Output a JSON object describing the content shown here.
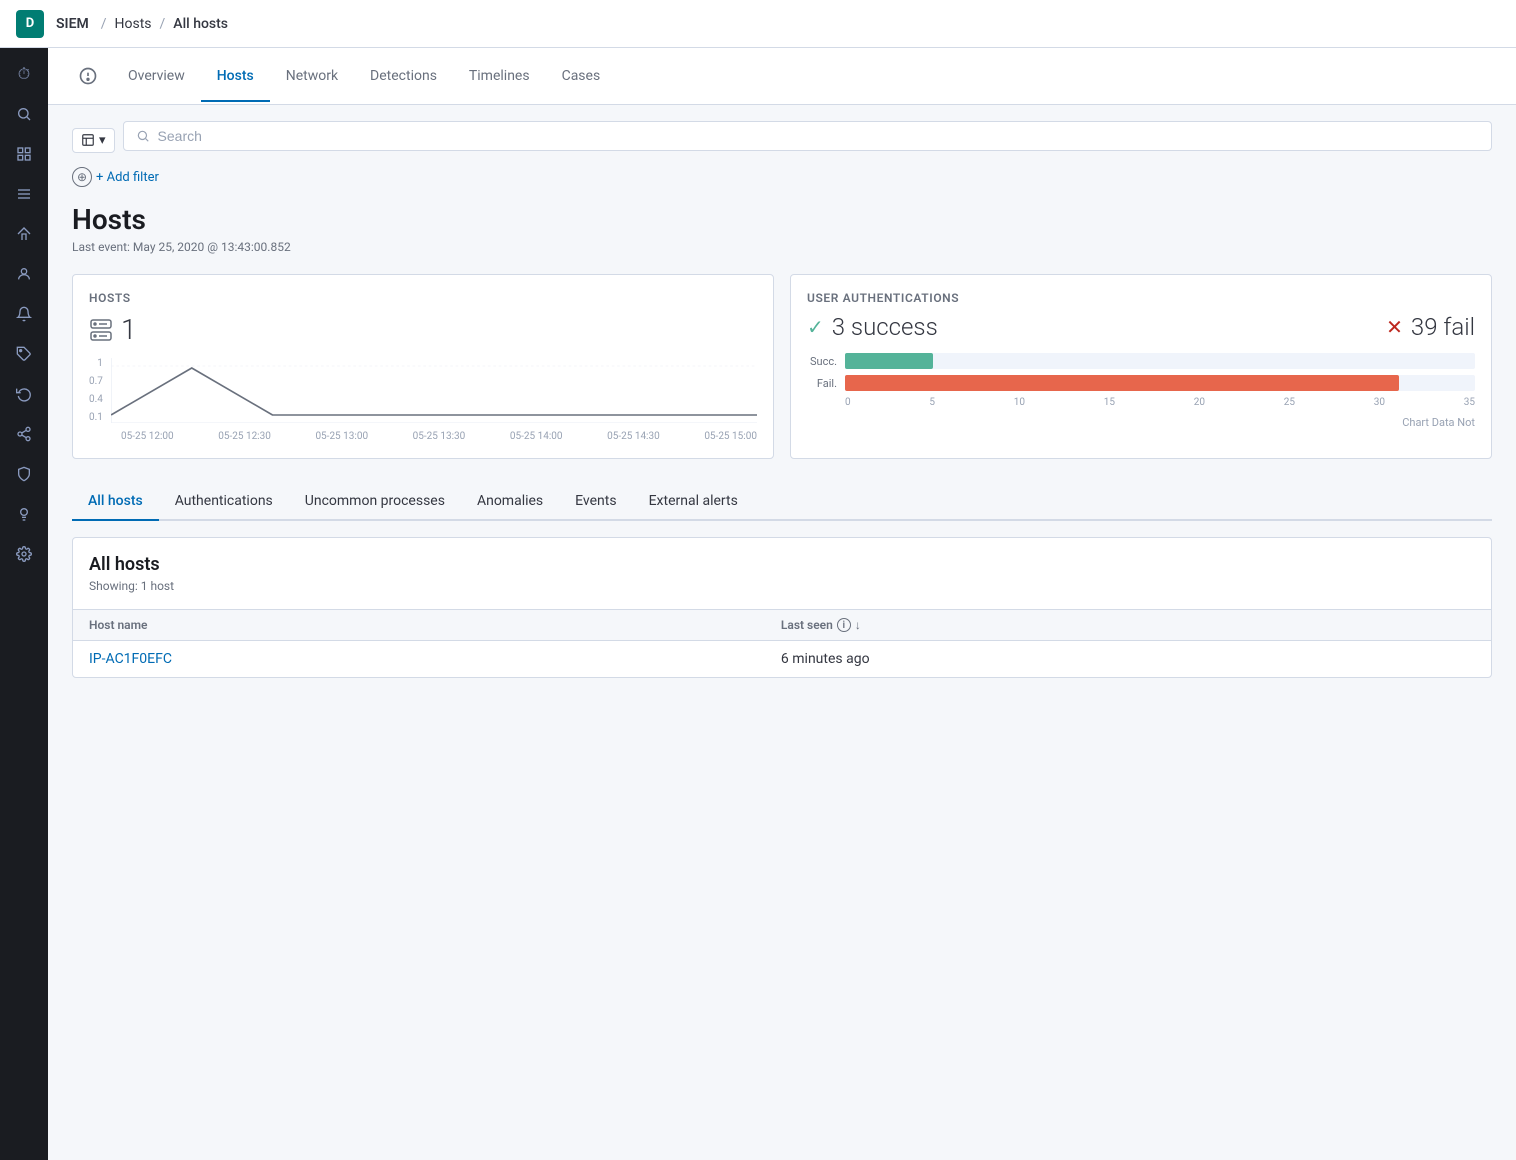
{
  "topbar": {
    "logo_text": "D",
    "brand": "SIEM",
    "breadcrumbs": [
      "SIEM",
      "Hosts",
      "All hosts"
    ]
  },
  "sidebar": {
    "icons": [
      {
        "name": "clock-icon",
        "symbol": "🕐",
        "active": false
      },
      {
        "name": "search-icon",
        "symbol": "🔍",
        "active": false
      },
      {
        "name": "chart-icon",
        "symbol": "📊",
        "active": false
      },
      {
        "name": "grid-icon",
        "symbol": "⊞",
        "active": false
      },
      {
        "name": "store-icon",
        "symbol": "🏠",
        "active": false
      },
      {
        "name": "person-icon",
        "symbol": "👤",
        "active": false
      },
      {
        "name": "alert-icon",
        "symbol": "🔔",
        "active": false
      },
      {
        "name": "tag-icon",
        "symbol": "🏷",
        "active": false
      },
      {
        "name": "refresh-icon",
        "symbol": "↻",
        "active": false
      },
      {
        "name": "star-icon",
        "symbol": "★",
        "active": false
      },
      {
        "name": "shield-icon",
        "symbol": "🛡",
        "active": false
      },
      {
        "name": "bulb-icon",
        "symbol": "💡",
        "active": false
      },
      {
        "name": "settings-icon",
        "symbol": "⚙",
        "active": false
      }
    ]
  },
  "nav_tabs": {
    "items": [
      "Overview",
      "Hosts",
      "Network",
      "Detections",
      "Timelines",
      "Cases"
    ],
    "active": "Hosts"
  },
  "search": {
    "placeholder": "Search",
    "field_selector_label": "▼"
  },
  "filter": {
    "add_label": "+ Add filter"
  },
  "page": {
    "title": "Hosts",
    "last_event": "Last event: May 25, 2020 @ 13:43:00.852"
  },
  "hosts_card": {
    "title": "Hosts",
    "count": "1",
    "chart_y_labels": [
      "1",
      "0.7",
      "0.4",
      "0.1"
    ],
    "chart_x_labels": [
      "05-25 12:00",
      "05-25 12:30",
      "05-25 13:00",
      "05-25 13:30",
      "05-25 14:00",
      "05-25 14:30",
      "05-25 15:00"
    ]
  },
  "auth_card": {
    "title": "User authentications",
    "success_count": "3 success",
    "fail_count": "39 fail",
    "chart_not_available": "Chart Data Not",
    "bar_succ_label": "Succ.",
    "bar_fail_label": "Fail.",
    "bar_succ_width": 14,
    "bar_fail_width": 88,
    "bar_x_labels": [
      "0",
      "5",
      "10",
      "15",
      "20",
      "25",
      "30",
      "35"
    ]
  },
  "section_tabs": {
    "items": [
      "All hosts",
      "Authentications",
      "Uncommon processes",
      "Anomalies",
      "Events",
      "External alerts"
    ],
    "active": "All hosts"
  },
  "all_hosts_table": {
    "title": "All hosts",
    "showing": "Showing: 1 host",
    "columns": [
      "Host name",
      "Last seen"
    ],
    "rows": [
      {
        "host_name": "IP-AC1F0EFC",
        "last_seen": "6 minutes ago"
      }
    ]
  }
}
